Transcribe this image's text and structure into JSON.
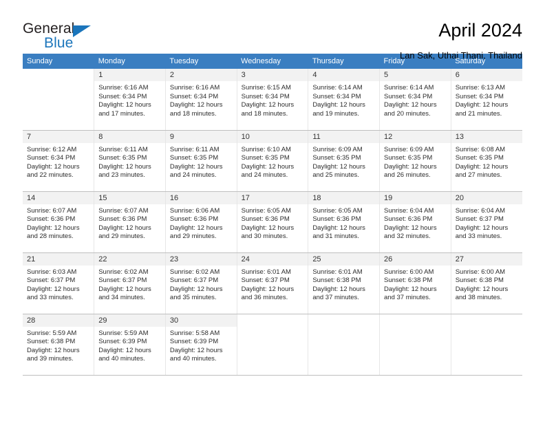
{
  "brand": {
    "name_part1": "General",
    "name_part2": "Blue",
    "accent_color": "#1b75bb"
  },
  "header": {
    "title": "April 2024",
    "location": "Lan Sak, Uthai Thani, Thailand"
  },
  "calendar": {
    "header_bg": "#3a7ec1",
    "daynum_bg": "#f2f2f2",
    "weekdays": [
      "Sunday",
      "Monday",
      "Tuesday",
      "Wednesday",
      "Thursday",
      "Friday",
      "Saturday"
    ],
    "labels": {
      "sunrise": "Sunrise:",
      "sunset": "Sunset:",
      "daylight": "Daylight:"
    },
    "weeks": [
      [
        {
          "day": "",
          "sunrise": "",
          "sunset": "",
          "daylight_line1": "",
          "daylight_line2": ""
        },
        {
          "day": "1",
          "sunrise": "Sunrise: 6:16 AM",
          "sunset": "Sunset: 6:34 PM",
          "daylight_line1": "Daylight: 12 hours",
          "daylight_line2": "and 17 minutes."
        },
        {
          "day": "2",
          "sunrise": "Sunrise: 6:16 AM",
          "sunset": "Sunset: 6:34 PM",
          "daylight_line1": "Daylight: 12 hours",
          "daylight_line2": "and 18 minutes."
        },
        {
          "day": "3",
          "sunrise": "Sunrise: 6:15 AM",
          "sunset": "Sunset: 6:34 PM",
          "daylight_line1": "Daylight: 12 hours",
          "daylight_line2": "and 18 minutes."
        },
        {
          "day": "4",
          "sunrise": "Sunrise: 6:14 AM",
          "sunset": "Sunset: 6:34 PM",
          "daylight_line1": "Daylight: 12 hours",
          "daylight_line2": "and 19 minutes."
        },
        {
          "day": "5",
          "sunrise": "Sunrise: 6:14 AM",
          "sunset": "Sunset: 6:34 PM",
          "daylight_line1": "Daylight: 12 hours",
          "daylight_line2": "and 20 minutes."
        },
        {
          "day": "6",
          "sunrise": "Sunrise: 6:13 AM",
          "sunset": "Sunset: 6:34 PM",
          "daylight_line1": "Daylight: 12 hours",
          "daylight_line2": "and 21 minutes."
        }
      ],
      [
        {
          "day": "7",
          "sunrise": "Sunrise: 6:12 AM",
          "sunset": "Sunset: 6:34 PM",
          "daylight_line1": "Daylight: 12 hours",
          "daylight_line2": "and 22 minutes."
        },
        {
          "day": "8",
          "sunrise": "Sunrise: 6:11 AM",
          "sunset": "Sunset: 6:35 PM",
          "daylight_line1": "Daylight: 12 hours",
          "daylight_line2": "and 23 minutes."
        },
        {
          "day": "9",
          "sunrise": "Sunrise: 6:11 AM",
          "sunset": "Sunset: 6:35 PM",
          "daylight_line1": "Daylight: 12 hours",
          "daylight_line2": "and 24 minutes."
        },
        {
          "day": "10",
          "sunrise": "Sunrise: 6:10 AM",
          "sunset": "Sunset: 6:35 PM",
          "daylight_line1": "Daylight: 12 hours",
          "daylight_line2": "and 24 minutes."
        },
        {
          "day": "11",
          "sunrise": "Sunrise: 6:09 AM",
          "sunset": "Sunset: 6:35 PM",
          "daylight_line1": "Daylight: 12 hours",
          "daylight_line2": "and 25 minutes."
        },
        {
          "day": "12",
          "sunrise": "Sunrise: 6:09 AM",
          "sunset": "Sunset: 6:35 PM",
          "daylight_line1": "Daylight: 12 hours",
          "daylight_line2": "and 26 minutes."
        },
        {
          "day": "13",
          "sunrise": "Sunrise: 6:08 AM",
          "sunset": "Sunset: 6:35 PM",
          "daylight_line1": "Daylight: 12 hours",
          "daylight_line2": "and 27 minutes."
        }
      ],
      [
        {
          "day": "14",
          "sunrise": "Sunrise: 6:07 AM",
          "sunset": "Sunset: 6:36 PM",
          "daylight_line1": "Daylight: 12 hours",
          "daylight_line2": "and 28 minutes."
        },
        {
          "day": "15",
          "sunrise": "Sunrise: 6:07 AM",
          "sunset": "Sunset: 6:36 PM",
          "daylight_line1": "Daylight: 12 hours",
          "daylight_line2": "and 29 minutes."
        },
        {
          "day": "16",
          "sunrise": "Sunrise: 6:06 AM",
          "sunset": "Sunset: 6:36 PM",
          "daylight_line1": "Daylight: 12 hours",
          "daylight_line2": "and 29 minutes."
        },
        {
          "day": "17",
          "sunrise": "Sunrise: 6:05 AM",
          "sunset": "Sunset: 6:36 PM",
          "daylight_line1": "Daylight: 12 hours",
          "daylight_line2": "and 30 minutes."
        },
        {
          "day": "18",
          "sunrise": "Sunrise: 6:05 AM",
          "sunset": "Sunset: 6:36 PM",
          "daylight_line1": "Daylight: 12 hours",
          "daylight_line2": "and 31 minutes."
        },
        {
          "day": "19",
          "sunrise": "Sunrise: 6:04 AM",
          "sunset": "Sunset: 6:36 PM",
          "daylight_line1": "Daylight: 12 hours",
          "daylight_line2": "and 32 minutes."
        },
        {
          "day": "20",
          "sunrise": "Sunrise: 6:04 AM",
          "sunset": "Sunset: 6:37 PM",
          "daylight_line1": "Daylight: 12 hours",
          "daylight_line2": "and 33 minutes."
        }
      ],
      [
        {
          "day": "21",
          "sunrise": "Sunrise: 6:03 AM",
          "sunset": "Sunset: 6:37 PM",
          "daylight_line1": "Daylight: 12 hours",
          "daylight_line2": "and 33 minutes."
        },
        {
          "day": "22",
          "sunrise": "Sunrise: 6:02 AM",
          "sunset": "Sunset: 6:37 PM",
          "daylight_line1": "Daylight: 12 hours",
          "daylight_line2": "and 34 minutes."
        },
        {
          "day": "23",
          "sunrise": "Sunrise: 6:02 AM",
          "sunset": "Sunset: 6:37 PM",
          "daylight_line1": "Daylight: 12 hours",
          "daylight_line2": "and 35 minutes."
        },
        {
          "day": "24",
          "sunrise": "Sunrise: 6:01 AM",
          "sunset": "Sunset: 6:37 PM",
          "daylight_line1": "Daylight: 12 hours",
          "daylight_line2": "and 36 minutes."
        },
        {
          "day": "25",
          "sunrise": "Sunrise: 6:01 AM",
          "sunset": "Sunset: 6:38 PM",
          "daylight_line1": "Daylight: 12 hours",
          "daylight_line2": "and 37 minutes."
        },
        {
          "day": "26",
          "sunrise": "Sunrise: 6:00 AM",
          "sunset": "Sunset: 6:38 PM",
          "daylight_line1": "Daylight: 12 hours",
          "daylight_line2": "and 37 minutes."
        },
        {
          "day": "27",
          "sunrise": "Sunrise: 6:00 AM",
          "sunset": "Sunset: 6:38 PM",
          "daylight_line1": "Daylight: 12 hours",
          "daylight_line2": "and 38 minutes."
        }
      ],
      [
        {
          "day": "28",
          "sunrise": "Sunrise: 5:59 AM",
          "sunset": "Sunset: 6:38 PM",
          "daylight_line1": "Daylight: 12 hours",
          "daylight_line2": "and 39 minutes."
        },
        {
          "day": "29",
          "sunrise": "Sunrise: 5:59 AM",
          "sunset": "Sunset: 6:39 PM",
          "daylight_line1": "Daylight: 12 hours",
          "daylight_line2": "and 40 minutes."
        },
        {
          "day": "30",
          "sunrise": "Sunrise: 5:58 AM",
          "sunset": "Sunset: 6:39 PM",
          "daylight_line1": "Daylight: 12 hours",
          "daylight_line2": "and 40 minutes."
        },
        {
          "day": "",
          "sunrise": "",
          "sunset": "",
          "daylight_line1": "",
          "daylight_line2": ""
        },
        {
          "day": "",
          "sunrise": "",
          "sunset": "",
          "daylight_line1": "",
          "daylight_line2": ""
        },
        {
          "day": "",
          "sunrise": "",
          "sunset": "",
          "daylight_line1": "",
          "daylight_line2": ""
        },
        {
          "day": "",
          "sunrise": "",
          "sunset": "",
          "daylight_line1": "",
          "daylight_line2": ""
        }
      ]
    ]
  }
}
